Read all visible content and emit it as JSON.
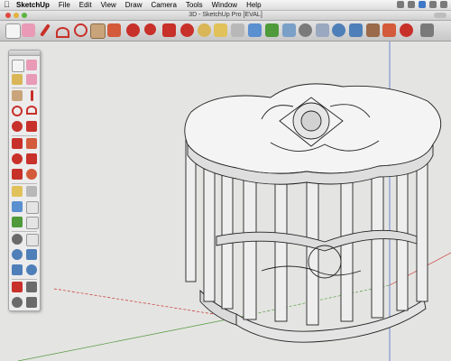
{
  "menubar": {
    "apple_icon": "apple-icon",
    "items": [
      "SketchUp",
      "File",
      "Edit",
      "View",
      "Draw",
      "Camera",
      "Tools",
      "Window",
      "Help"
    ]
  },
  "window": {
    "title": "3D - SketchUp Pro [EVAL]"
  },
  "colors": {
    "accent_red": "#c8302a",
    "accent_blue": "#3f78c8",
    "accent_green": "#4f9a3a",
    "model_face": "#eeeeee"
  },
  "toolbar": {
    "tools": [
      "select",
      "eraser",
      "pencil",
      "arc",
      "circle",
      "rectangle",
      "push-pull",
      "move",
      "rotate",
      "follow-me",
      "scale",
      "offset",
      "tape-measure",
      "dimension",
      "protractor",
      "text",
      "paint-bucket",
      "orbit",
      "pan",
      "zoom",
      "zoom-extents",
      "previous-view",
      "next-view",
      "warehouse",
      "share",
      "extension"
    ]
  },
  "palette": {
    "tools": [
      "select",
      "make-component",
      "paint-bucket",
      "eraser",
      "rectangle",
      "line",
      "circle",
      "arc",
      "polygon",
      "freehand",
      "move",
      "push-pull",
      "rotate",
      "follow-me",
      "scale",
      "offset",
      "tape-measure",
      "dimension",
      "protractor",
      "text",
      "axes",
      "3d-text",
      "orbit",
      "pan",
      "zoom",
      "zoom-window",
      "zoom-extents",
      "previous",
      "position-camera",
      "walk",
      "look-around",
      "section-plane"
    ]
  }
}
